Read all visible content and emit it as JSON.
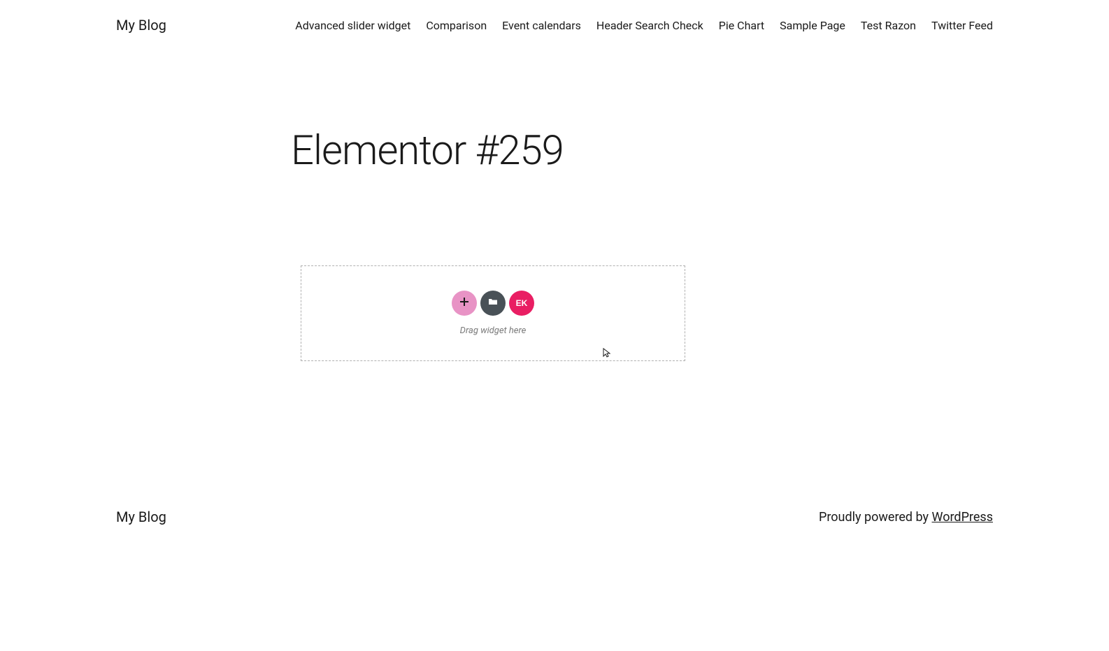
{
  "header": {
    "site_title": "My Blog",
    "nav_items": [
      "Advanced slider widget",
      "Comparison",
      "Event calendars",
      "Header Search Check",
      "Pie Chart",
      "Sample Page",
      "Test Razon",
      "Twitter Feed"
    ]
  },
  "main": {
    "page_title": "Elementor #259",
    "drop_zone": {
      "hint_text": "Drag widget here",
      "ek_label": "EK"
    }
  },
  "footer": {
    "site_title": "My Blog",
    "powered_by_text": "Proudly powered by ",
    "powered_by_link": "WordPress"
  }
}
